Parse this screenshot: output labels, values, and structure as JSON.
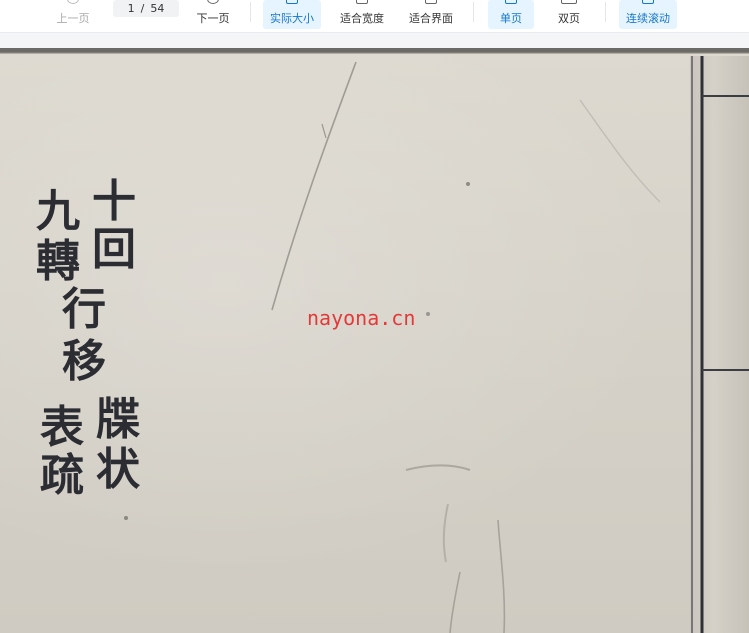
{
  "toolbar": {
    "prev_label": "上一页",
    "page_current": "1",
    "page_separator": "/",
    "page_total": "54",
    "next_label": "下一页",
    "actual_size_label": "实际大小",
    "fit_width_label": "适合宽度",
    "fit_page_label": "适合界面",
    "single_page_label": "单页",
    "double_page_label": "双页",
    "continuous_label": "连续滚动",
    "accent_color": "#1677c9"
  },
  "document": {
    "title_column_right": [
      "十",
      "回",
      "行",
      "移",
      "牒",
      "状"
    ],
    "title_column_left": [
      "九",
      "轉",
      "表",
      "疏"
    ],
    "watermark": "nayona.cn"
  }
}
